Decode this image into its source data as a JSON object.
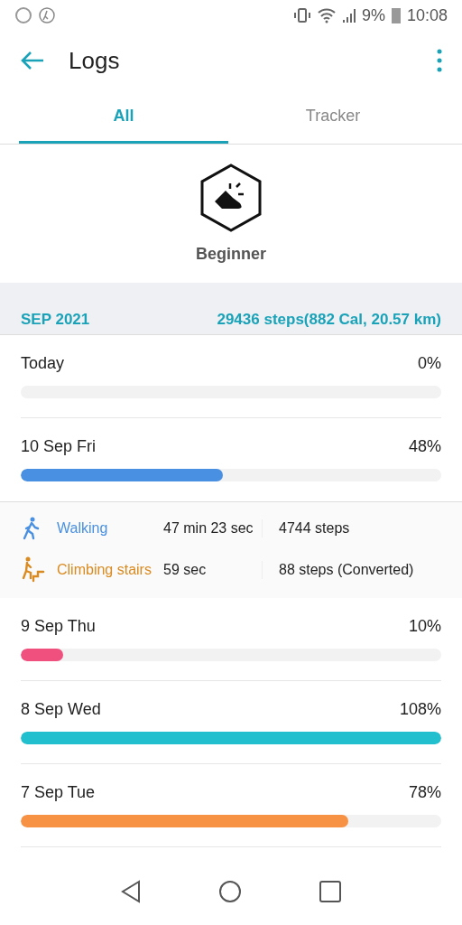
{
  "status_bar": {
    "battery": "9%",
    "time": "10:08"
  },
  "app_bar": {
    "title": "Logs"
  },
  "tabs": [
    {
      "label": "All",
      "selected": true
    },
    {
      "label": "Tracker",
      "selected": false
    }
  ],
  "badge": {
    "label": "Beginner"
  },
  "month": {
    "label": "SEP 2021",
    "summary": "29436 steps(882 Cal, 20.57 km)"
  },
  "days": [
    {
      "label": "Today",
      "percent": "0%",
      "expanded": false
    },
    {
      "label": "10 Sep Fri",
      "percent": "48%",
      "level": 0.48,
      "color": "#4a90e2",
      "expanded": true,
      "activities": [
        {
          "kind": "walking",
          "name": "Walking",
          "duration": "47 min 23 sec",
          "steps": "4744 steps",
          "color": "#4a90e2"
        },
        {
          "kind": "stairs",
          "name": "Climbing stairs",
          "duration": "59 sec",
          "steps": "88 steps (Converted)",
          "color": "#db8a1f"
        }
      ]
    },
    {
      "label": "9 Sep Thu",
      "percent": "10%",
      "level": 0.1,
      "color": "#f0507e",
      "expanded": false
    },
    {
      "label": "8 Sep Wed",
      "percent": "108%",
      "level": 1,
      "color": "#22bfcf",
      "expanded": false
    },
    {
      "label": "7 Sep Tue",
      "percent": "78%",
      "level": 0.78,
      "color": "#f79245",
      "expanded": false
    }
  ]
}
